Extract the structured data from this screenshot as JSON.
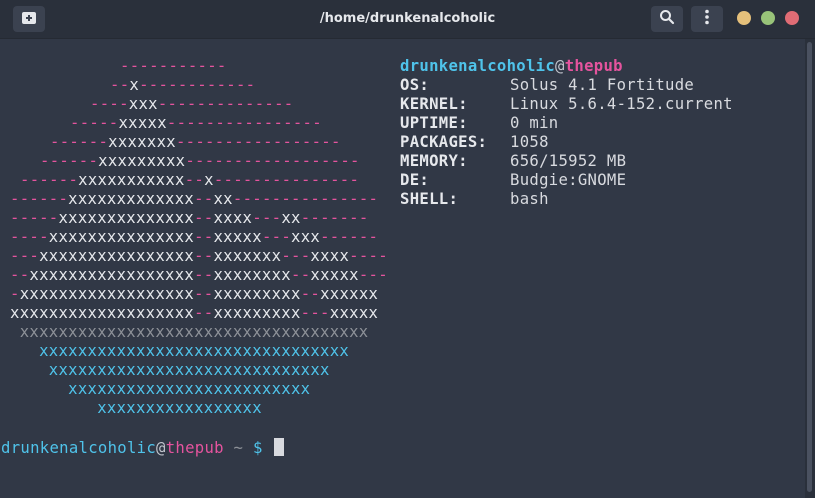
{
  "window": {
    "title": "/home/drunkenalcoholic",
    "buttons": {
      "new_tab_icon": "new-tab-icon",
      "search_icon": "search-icon",
      "menu_icon": "kebab-menu-icon"
    },
    "controls": {
      "minimize_color": "#e5c07b",
      "maximize_color": "#98c379",
      "close_color": "#e06c75"
    }
  },
  "colors": {
    "pink": "#e5549e",
    "blue": "#4fc3ea",
    "white": "#e6e8ec",
    "gray": "#8d9198",
    "background": "#313846"
  },
  "ascii_art": [
    [
      [
        "p",
        "-----------"
      ]
    ],
    [
      [
        "p",
        "--"
      ],
      [
        "w",
        "x"
      ],
      [
        "p",
        "------------"
      ]
    ],
    [
      [
        "p",
        "----"
      ],
      [
        "w",
        "xxx"
      ],
      [
        "p",
        "--------------"
      ]
    ],
    [
      [
        "p",
        "-----"
      ],
      [
        "w",
        "xxxxx"
      ],
      [
        "p",
        "----------------"
      ]
    ],
    [
      [
        "p",
        "------"
      ],
      [
        "w",
        "xxxxxxx"
      ],
      [
        "p",
        "-----------------"
      ]
    ],
    [
      [
        "p",
        "------"
      ],
      [
        "w",
        "xxxxxxxxx"
      ],
      [
        "p",
        "------------------"
      ]
    ],
    [
      [
        "p",
        "------"
      ],
      [
        "w",
        "xxxxxxxxxxx"
      ],
      [
        "p",
        "--"
      ],
      [
        "w",
        "x"
      ],
      [
        "p",
        "---------------"
      ]
    ],
    [
      [
        "p",
        "------"
      ],
      [
        "w",
        "xxxxxxxxxxxxx"
      ],
      [
        "p",
        "--"
      ],
      [
        "w",
        "xx"
      ],
      [
        "p",
        "---------------"
      ]
    ],
    [
      [
        "p",
        "-----"
      ],
      [
        "w",
        "xxxxxxxxxxxxxx"
      ],
      [
        "p",
        "--"
      ],
      [
        "w",
        "xxxx"
      ],
      [
        "p",
        "---"
      ],
      [
        "w",
        "xx"
      ],
      [
        "p",
        "-------"
      ]
    ],
    [
      [
        "p",
        "----"
      ],
      [
        "w",
        "xxxxxxxxxxxxxxx"
      ],
      [
        "p",
        "--"
      ],
      [
        "w",
        "xxxxx"
      ],
      [
        "p",
        "---"
      ],
      [
        "w",
        "xxx"
      ],
      [
        "p",
        "------"
      ]
    ],
    [
      [
        "p",
        "---"
      ],
      [
        "w",
        "xxxxxxxxxxxxxxxx"
      ],
      [
        "p",
        "--"
      ],
      [
        "w",
        "xxxxxxx"
      ],
      [
        "p",
        "---"
      ],
      [
        "w",
        "xxxx"
      ],
      [
        "p",
        "----"
      ]
    ],
    [
      [
        "p",
        "--"
      ],
      [
        "w",
        "xxxxxxxxxxxxxxxxx"
      ],
      [
        "p",
        "--"
      ],
      [
        "w",
        "xxxxxxxx"
      ],
      [
        "p",
        "--"
      ],
      [
        "w",
        "xxxxx"
      ],
      [
        "p",
        "---"
      ]
    ],
    [
      [
        "p",
        "-"
      ],
      [
        "w",
        "xxxxxxxxxxxxxxxxxx"
      ],
      [
        "p",
        "--"
      ],
      [
        "w",
        "xxxxxxxxx"
      ],
      [
        "p",
        "--"
      ],
      [
        "w",
        "xxxxxx"
      ]
    ],
    [
      [
        "w",
        "xxxxxxxxxxxxxxxxxxx"
      ],
      [
        "p",
        "--"
      ],
      [
        "w",
        "xxxxxxxxx"
      ],
      [
        "p",
        "---"
      ],
      [
        "w",
        "xxxxx"
      ]
    ],
    [
      [
        "g",
        " xxxxxxxxxxxxxxxxxxxxxxxxxxxxxxxxxxxx"
      ]
    ],
    [
      [
        "b",
        "   xxxxxxxxxxxxxxxxxxxxxxxxxxxxxxxx"
      ]
    ],
    [
      [
        "b",
        "    xxxxxxxxxxxxxxxxxxxxxxxxxxxxx"
      ]
    ],
    [
      [
        "b",
        "      xxxxxxxxxxxxxxxxxxxxxxxxx"
      ]
    ],
    [
      [
        "b",
        "         xxxxxxxxxxxxxxxxx"
      ]
    ]
  ],
  "info": {
    "user": "drunkenalcoholic",
    "at": "@",
    "host": "thepub",
    "rows": [
      {
        "key": "OS:",
        "value": "Solus 4.1 Fortitude"
      },
      {
        "key": "KERNEL:",
        "value": "Linux 5.6.4-152.current"
      },
      {
        "key": "UPTIME:",
        "value": "0 min"
      },
      {
        "key": "PACKAGES:",
        "value": "1058"
      },
      {
        "key": "MEMORY:",
        "value": "656/15952 MB"
      },
      {
        "key": "DE:",
        "value": "Budgie:GNOME"
      },
      {
        "key": "SHELL:",
        "value": "bash"
      }
    ]
  },
  "prompt": {
    "user": "drunkenalcoholic",
    "at": "@",
    "host": "thepub",
    "path": " ~ ",
    "symbol": "$ "
  }
}
